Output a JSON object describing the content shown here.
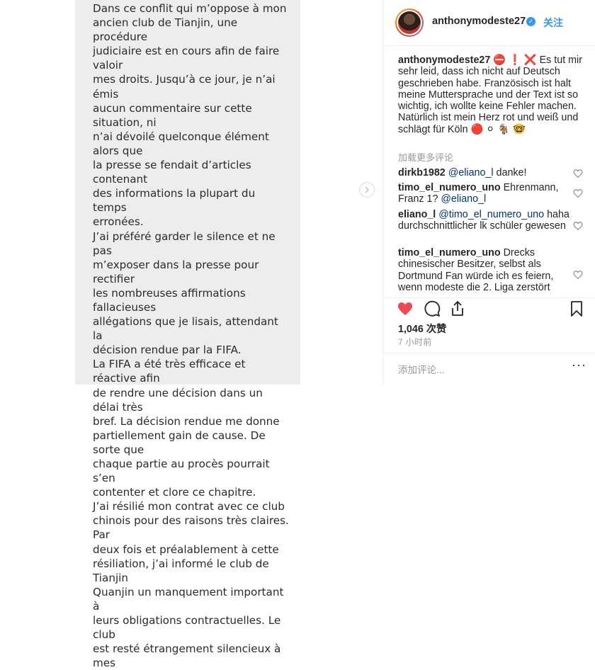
{
  "post_text": "Dans ce conflit qui m’oppose à mon\nancien club de Tianjin, une procédure\njudiciaire est en cours afin de faire valoir\nmes droits. Jusqu’à ce jour, je n’ai émis\naucun commentaire sur cette situation, ni\nn’ai dévoilé quelconque élément alors que\nla presse se fendait d’articles contenant\ndes informations la plupart du temps\nerronées.\n J’ai préféré garder le silence et ne pas\nm’exposer dans la presse pour rectifier\nles nombreuses affirmations fallacieuses\nallégations que je lisais, attendant la\ndécision rendue par la FIFA.\n La FIFA a été très efficace et réactive afin\nde rendre une décision dans un délai très\nbref.  La décision rendue me donne\npartiellement gain de cause. De sorte que\nchaque partie au procès pourrait s’en\ncontenter et clore ce chapitre.\nJ’ai résilié mon contrat avec ce club\nchinois pour des raisons très claires. Par\ndeux fois et préalablement à cette\nrésiliation, j’ai informé le club de Tianjin\nQuanjin un manquement important à\nleurs obligations contractuelles. Le club\nest resté étrangement silencieux à mes",
  "header": {
    "username": "anthonymodeste27",
    "verified_glyph": "✓",
    "follow_label": "关注"
  },
  "caption": {
    "username": "anthonymodeste27",
    "emoji_prefix": "⛔ ❗ ❌",
    "text": "Es tut mir sehr leid, dass ich nicht auf Deutsch geschrieben habe. Französisch ist halt meine Muttersprache und der Text ist so wichtig, ich wollte keine Fehler machen. Natürlich ist mein Herz rot und weiß und schlägt für Köln",
    "emoji_suffix": "🔴 ⚪ 🐐 🤓"
  },
  "load_more_label": "加载更多评论",
  "comments": [
    {
      "user": "dirkb1982",
      "mention": "@eliano_l",
      "text": "danke!"
    },
    {
      "user": "timo_el_numero_uno",
      "mention": "",
      "text": "Ehrenmann, Franz 1?",
      "mention_after": "@eliano_l"
    },
    {
      "user": "eliano_l",
      "mention": "@timo_el_numero_uno",
      "text": "haha durchschnittlicher lk schüler gewesen"
    },
    {
      "user": "timo_el_numero_uno",
      "mention": "",
      "text": "Drecks chinesischer Besitzer, selbst als Dortmund Fan würde ich es feiern, wenn modeste die 2. Liga zerstört"
    }
  ],
  "likes": "1,046 次赞",
  "timestamp": "7 小时前",
  "add_comment_placeholder": "添加评论...",
  "more_glyph": "···",
  "colors": {
    "like_red": "#ed4956",
    "link_blue": "#3897f0",
    "mention_blue": "#003569"
  },
  "icons": [
    "chevron-right-icon",
    "verified-icon",
    "heart-icon",
    "comment-icon",
    "share-icon",
    "bookmark-icon",
    "small-heart-icon",
    "more-icon"
  ]
}
